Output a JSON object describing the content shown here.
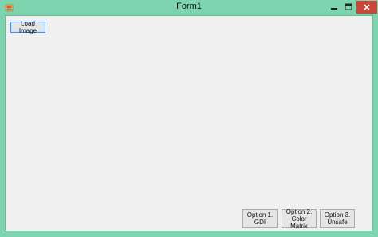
{
  "window": {
    "title": "Form1"
  },
  "titlebar_buttons": {
    "minimize_icon": "minimize-icon",
    "maximize_icon": "maximize-icon",
    "close_icon": "close-icon"
  },
  "colors": {
    "frame": "#7fd4b0",
    "close_button": "#c7483b",
    "client_background": "#f0f0f0"
  },
  "buttons": {
    "load_image": "Load Image",
    "option1": "Option 1.\nGDI",
    "option2": "Option 2.\nColor Matrix",
    "option3": "Option 3.\nUnsafe"
  }
}
